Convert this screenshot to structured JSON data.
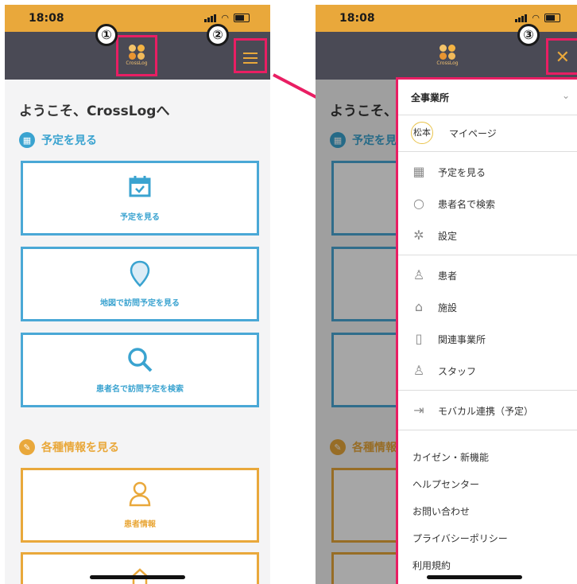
{
  "status": {
    "time": "18:08"
  },
  "logo": {
    "text": "CrossLog"
  },
  "badges": {
    "one": "①",
    "two": "②",
    "three": "③"
  },
  "home": {
    "welcome": "ようこそ、CrossLogへ",
    "section_schedule": "予定を見る",
    "section_info": "各種情報を見る",
    "cards": [
      {
        "label": "予定を見る",
        "icon": "calendar-icon"
      },
      {
        "label": "地図で訪問予定を見る",
        "icon": "map-pin-icon"
      },
      {
        "label": "患者名で訪問予定を検索",
        "icon": "search-icon"
      },
      {
        "label": "患者情報",
        "icon": "person-icon"
      }
    ]
  },
  "drawer": {
    "office_selector": "全事業所",
    "avatar_text": "松本",
    "mypage": "マイページ",
    "items": [
      {
        "label": "予定を見る",
        "icon": "calendar-icon"
      },
      {
        "label": "患者名で検索",
        "icon": "search-icon"
      },
      {
        "label": "設定",
        "icon": "gear-icon"
      },
      {
        "label": "患者",
        "icon": "person-icon"
      },
      {
        "label": "施設",
        "icon": "home-icon"
      },
      {
        "label": "関連事業所",
        "icon": "building-icon"
      },
      {
        "label": "スタッフ",
        "icon": "staff-icon"
      },
      {
        "label": "モバカル連携（予定）",
        "icon": "export-icon"
      }
    ],
    "links": [
      "カイゼン・新機能",
      "ヘルプセンター",
      "お問い合わせ",
      "プライバシーポリシー",
      "利用規約"
    ]
  },
  "colors": {
    "accent_orange": "#e9a83b",
    "accent_blue": "#3aa3d0",
    "highlight": "#e91e63",
    "appbar": "#4a4a55"
  }
}
